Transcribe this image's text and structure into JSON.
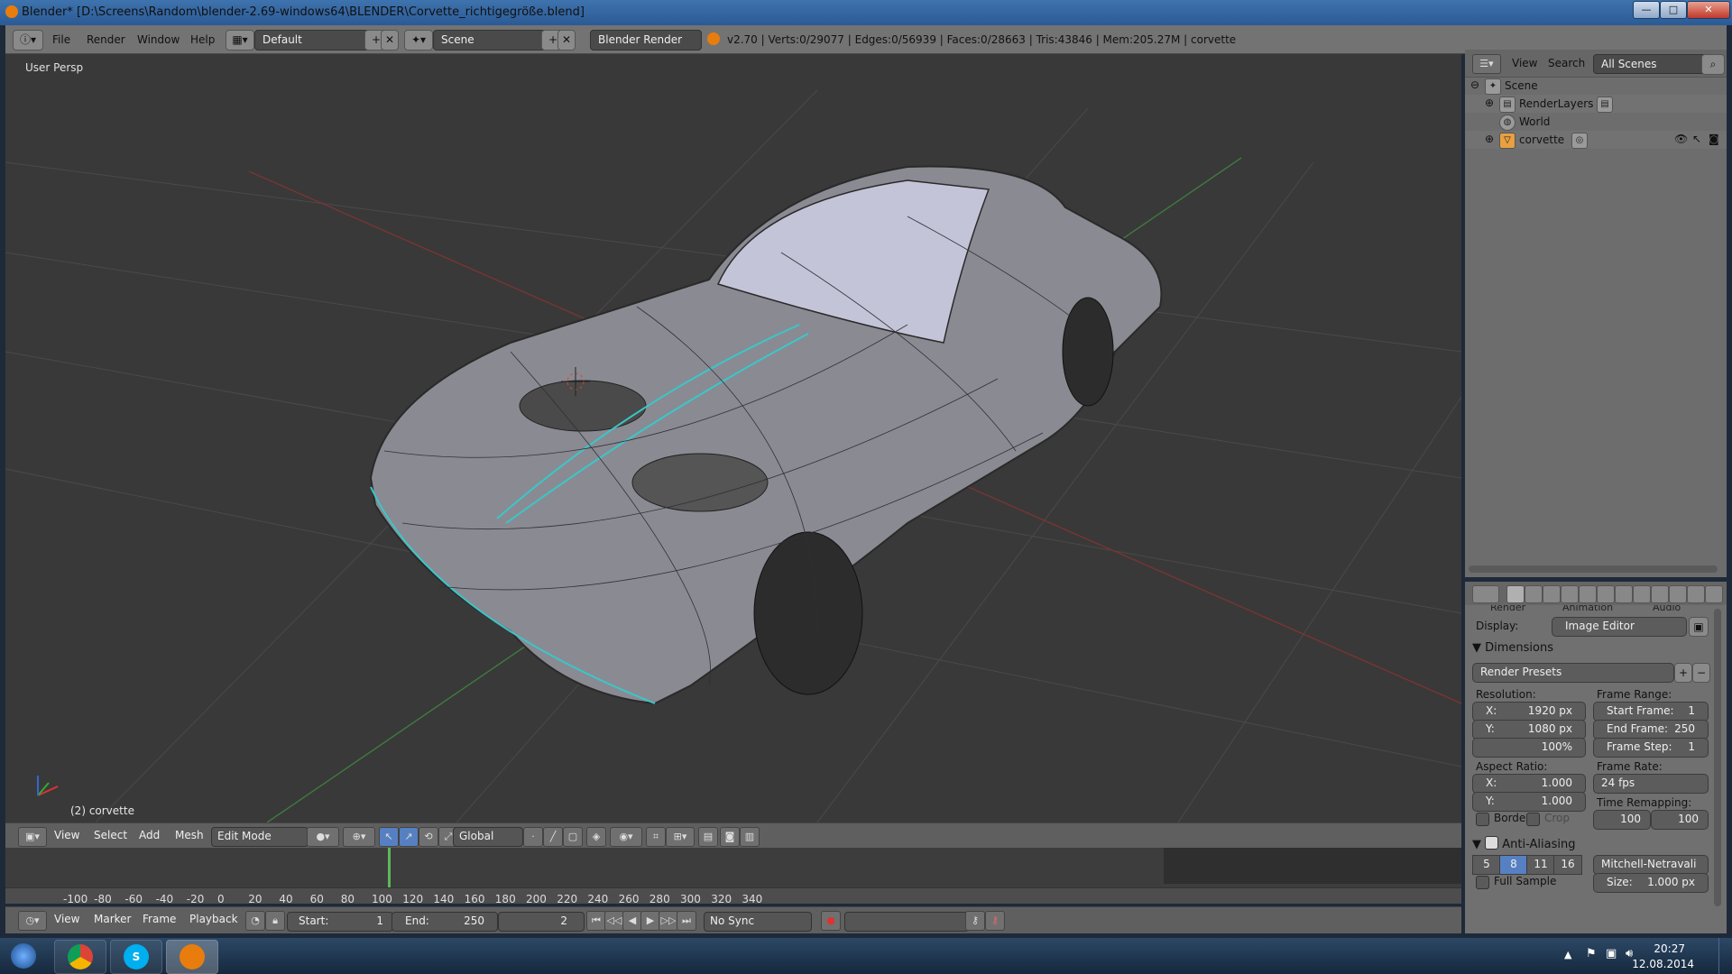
{
  "window": {
    "title": "Blender* [D:\\Screens\\Random\\blender-2.69-windows64\\BLENDER\\Corvette_richtigegröße.blend]",
    "min": "—",
    "max": "□",
    "close": "✕"
  },
  "info_header": {
    "menus": [
      "File",
      "Render",
      "Window",
      "Help"
    ],
    "layout": "Default",
    "scene": "Scene",
    "engine": "Blender Render",
    "stats": "v2.70 | Verts:0/29077 | Edges:0/56939 | Faces:0/28663 | Tris:43846 | Mem:205.27M | corvette"
  },
  "viewport": {
    "view_label": "User Persp",
    "object_label": "(2) corvette"
  },
  "view3d_header": {
    "menus": [
      "View",
      "Select",
      "Add",
      "Mesh"
    ],
    "mode": "Edit Mode",
    "orientation": "Global"
  },
  "timeline": {
    "ruler": [
      "-100",
      "-80",
      "-60",
      "-40",
      "-20",
      "0",
      "20",
      "40",
      "60",
      "80",
      "100",
      "120",
      "140",
      "160",
      "180",
      "200",
      "220",
      "240",
      "260",
      "280",
      "300",
      "320",
      "340"
    ],
    "current_frame_marker": 2,
    "menus": [
      "View",
      "Marker",
      "Frame",
      "Playback"
    ],
    "start_label": "Start:",
    "start_value": "1",
    "end_label": "End:",
    "end_value": "250",
    "current_frame": "2",
    "sync": "No Sync"
  },
  "outliner": {
    "menus": [
      "View",
      "Search"
    ],
    "filter": "All Scenes",
    "items": [
      "Scene",
      "RenderLayers",
      "World",
      "corvette"
    ]
  },
  "properties": {
    "tabs_partial": [
      "Render",
      "Animation",
      "Audio"
    ],
    "display_label": "Display:",
    "display_value": "Image Editor",
    "dimensions_title": "Dimensions",
    "render_presets": "Render Presets",
    "resolution_label": "Resolution:",
    "res_x_label": "X:",
    "res_x": "1920 px",
    "res_y_label": "Y:",
    "res_y": "1080 px",
    "res_pct": "100%",
    "frame_range_label": "Frame Range:",
    "start_frame_label": "Start Frame:",
    "start_frame": "1",
    "end_frame_label": "End Frame:",
    "end_frame": "250",
    "frame_step_label": "Frame Step:",
    "frame_step": "1",
    "aspect_label": "Aspect Ratio:",
    "asp_x_label": "X:",
    "asp_x": "1.000",
    "asp_y_label": "Y:",
    "asp_y": "1.000",
    "frame_rate_label": "Frame Rate:",
    "frame_rate": "24 fps",
    "time_remap_label": "Time Remapping:",
    "remap_old": "100",
    "remap_new": "100",
    "border_label": "Borde",
    "crop_label": "Crop",
    "aa_title": "Anti-Aliasing",
    "aa_samples": [
      "5",
      "8",
      "11",
      "16"
    ],
    "aa_filter": "Mitchell-Netravali",
    "full_sample_label": "Full Sample",
    "size_label": "Size:",
    "size_value": "1.000 px"
  },
  "taskbar": {
    "time": "20:27",
    "date": "12.08.2014"
  }
}
